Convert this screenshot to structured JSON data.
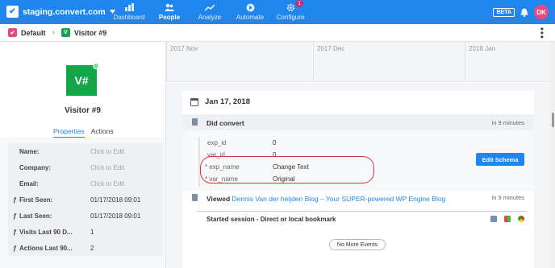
{
  "app": {
    "brand": "staging.convert.com",
    "logo_glyph": "✔",
    "dropdown_icon": "chevron-down-icon",
    "accent": "#1f86f0"
  },
  "nav": [
    {
      "label": "Dashboard",
      "icon": "dashboard-icon",
      "active": false
    },
    {
      "label": "People",
      "icon": "people-icon",
      "active": true
    },
    {
      "label": "Analyze",
      "icon": "analyze-icon",
      "active": false
    },
    {
      "label": "Automate",
      "icon": "automate-icon",
      "active": false
    },
    {
      "label": "Configure",
      "icon": "gear-icon",
      "active": false,
      "badge": "1"
    }
  ],
  "top_right": {
    "beta": "BETA",
    "avatar": "DK"
  },
  "breadcrumb": {
    "root": "Default",
    "root_glyph": "✔",
    "current": "Visitor #9",
    "current_glyph": "V"
  },
  "visitor": {
    "badge": "V#",
    "name": "Visitor #9"
  },
  "tabs": {
    "properties": "Properties",
    "actions": "Actions"
  },
  "properties": [
    {
      "label": "Name:",
      "value": "Click to Edit",
      "hint": true,
      "icon": false
    },
    {
      "label": "Company:",
      "value": "Click to Edit",
      "hint": true,
      "icon": false
    },
    {
      "label": "Email:",
      "value": "Click to Edit",
      "hint": true,
      "icon": false
    },
    {
      "label": "First Seen:",
      "value": "01/17/2018 09:01",
      "hint": false,
      "icon": true
    },
    {
      "label": "Last Seen:",
      "value": "01/17/2018 09:01",
      "hint": false,
      "icon": true
    },
    {
      "label": "Visits Last 90 D...",
      "value": "1",
      "hint": false,
      "icon": true
    },
    {
      "label": "Actions Last 90...",
      "value": "2",
      "hint": false,
      "icon": true
    }
  ],
  "timeline": {
    "months": [
      "2017 Nov",
      "2017 Dec",
      "2018 Jan"
    ]
  },
  "day": {
    "date": "Jan 17, 2018"
  },
  "event": {
    "title": "Did convert",
    "time": "in 9 minutes"
  },
  "details": [
    {
      "key": "exp_id",
      "value": "0"
    },
    {
      "key": "var_id",
      "value": "0"
    },
    {
      "key": "* exp_name",
      "value": "Change Text"
    },
    {
      "key": "* var_name",
      "value": "Original"
    }
  ],
  "edit_button": "Edit Schema",
  "viewed": {
    "prefix": "Viewed",
    "link": "Dennis Van der heijden Blog – Your SUPER-powered WP Engine Blog",
    "time": "in 9 minutes"
  },
  "session": {
    "label": "Started session - Direct or local bookmark"
  },
  "more_button": "No More Events"
}
